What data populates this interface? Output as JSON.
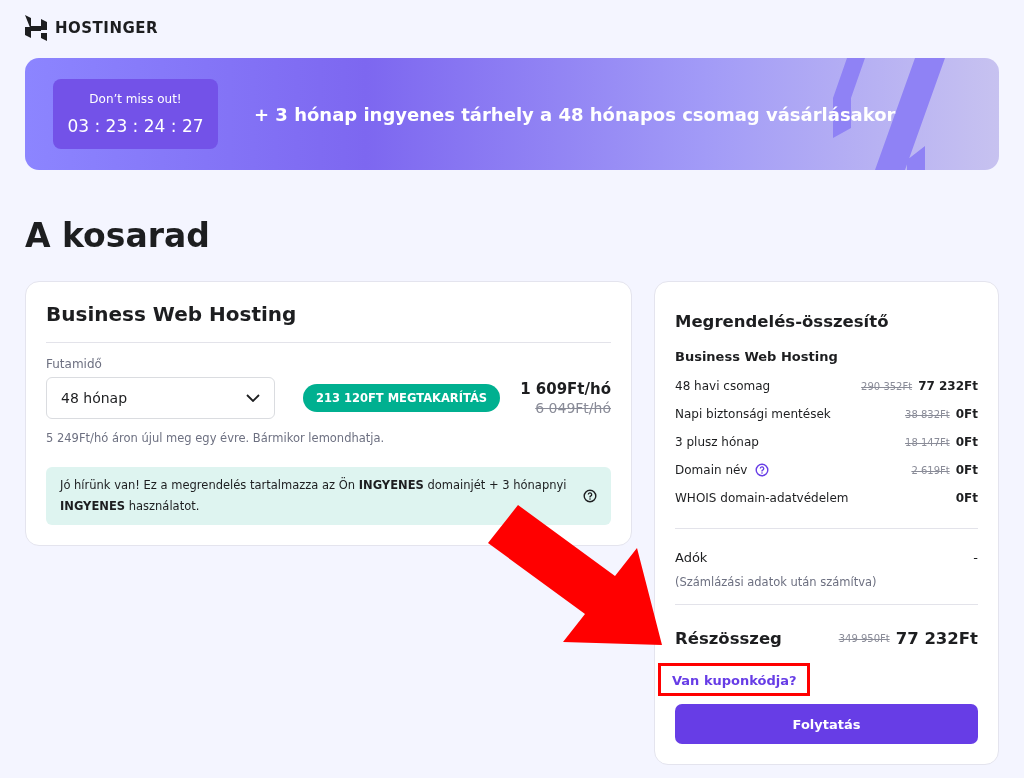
{
  "brand": {
    "name": "HOSTINGER"
  },
  "promo": {
    "countdown_title": "Don’t miss out!",
    "countdown": "03 : 23 : 24 : 27",
    "text": "+ 3 hónap ingyenes tárhely a 48 hónapos csomag vásárlásakor"
  },
  "heading": "A kosarad",
  "product": {
    "title": "Business Web Hosting",
    "period_label": "Futamidő",
    "period_value": "48 hónap",
    "savings_badge": "213 120FT MEGTAKARÍTÁS",
    "price": "1 609Ft/hó",
    "old_price": "6 049Ft/hó",
    "renewal_note": "5 249Ft/hó áron újul meg egy évre. Bármikor lemondhatja.",
    "notice": "Jó hírünk van! Ez a megrendelés tartalmazza az Ön **INGYENES** domainjét + 3 hónapnyi **INGYENES** használatot."
  },
  "summary": {
    "title": "Megrendelés-összesítő",
    "product": "Business Web Hosting",
    "items": [
      {
        "label": "48 havi csomag",
        "old_price": "290 352Ft",
        "price": "77 232Ft",
        "info": false
      },
      {
        "label": "Napi biztonsági mentések",
        "old_price": "38 832Ft",
        "price": "0Ft",
        "info": false
      },
      {
        "label": "3 plusz hónap",
        "old_price": "18 147Ft",
        "price": "0Ft",
        "info": false
      },
      {
        "label": "Domain név",
        "old_price": "2 619Ft",
        "price": "0Ft",
        "info": true
      },
      {
        "label": "WHOIS domain-adatvédelem",
        "price": "0Ft",
        "info": false
      }
    ],
    "taxes_label": "Adók",
    "taxes_note": "(Számlázási adatok után számítva)",
    "taxes_value": "-",
    "subtotal_label": "Részösszeg",
    "subtotal_old": "349 950Ft",
    "subtotal": "77 232Ft",
    "coupon_link": "Van kuponkódja?",
    "continue_button": "Folytatás"
  }
}
